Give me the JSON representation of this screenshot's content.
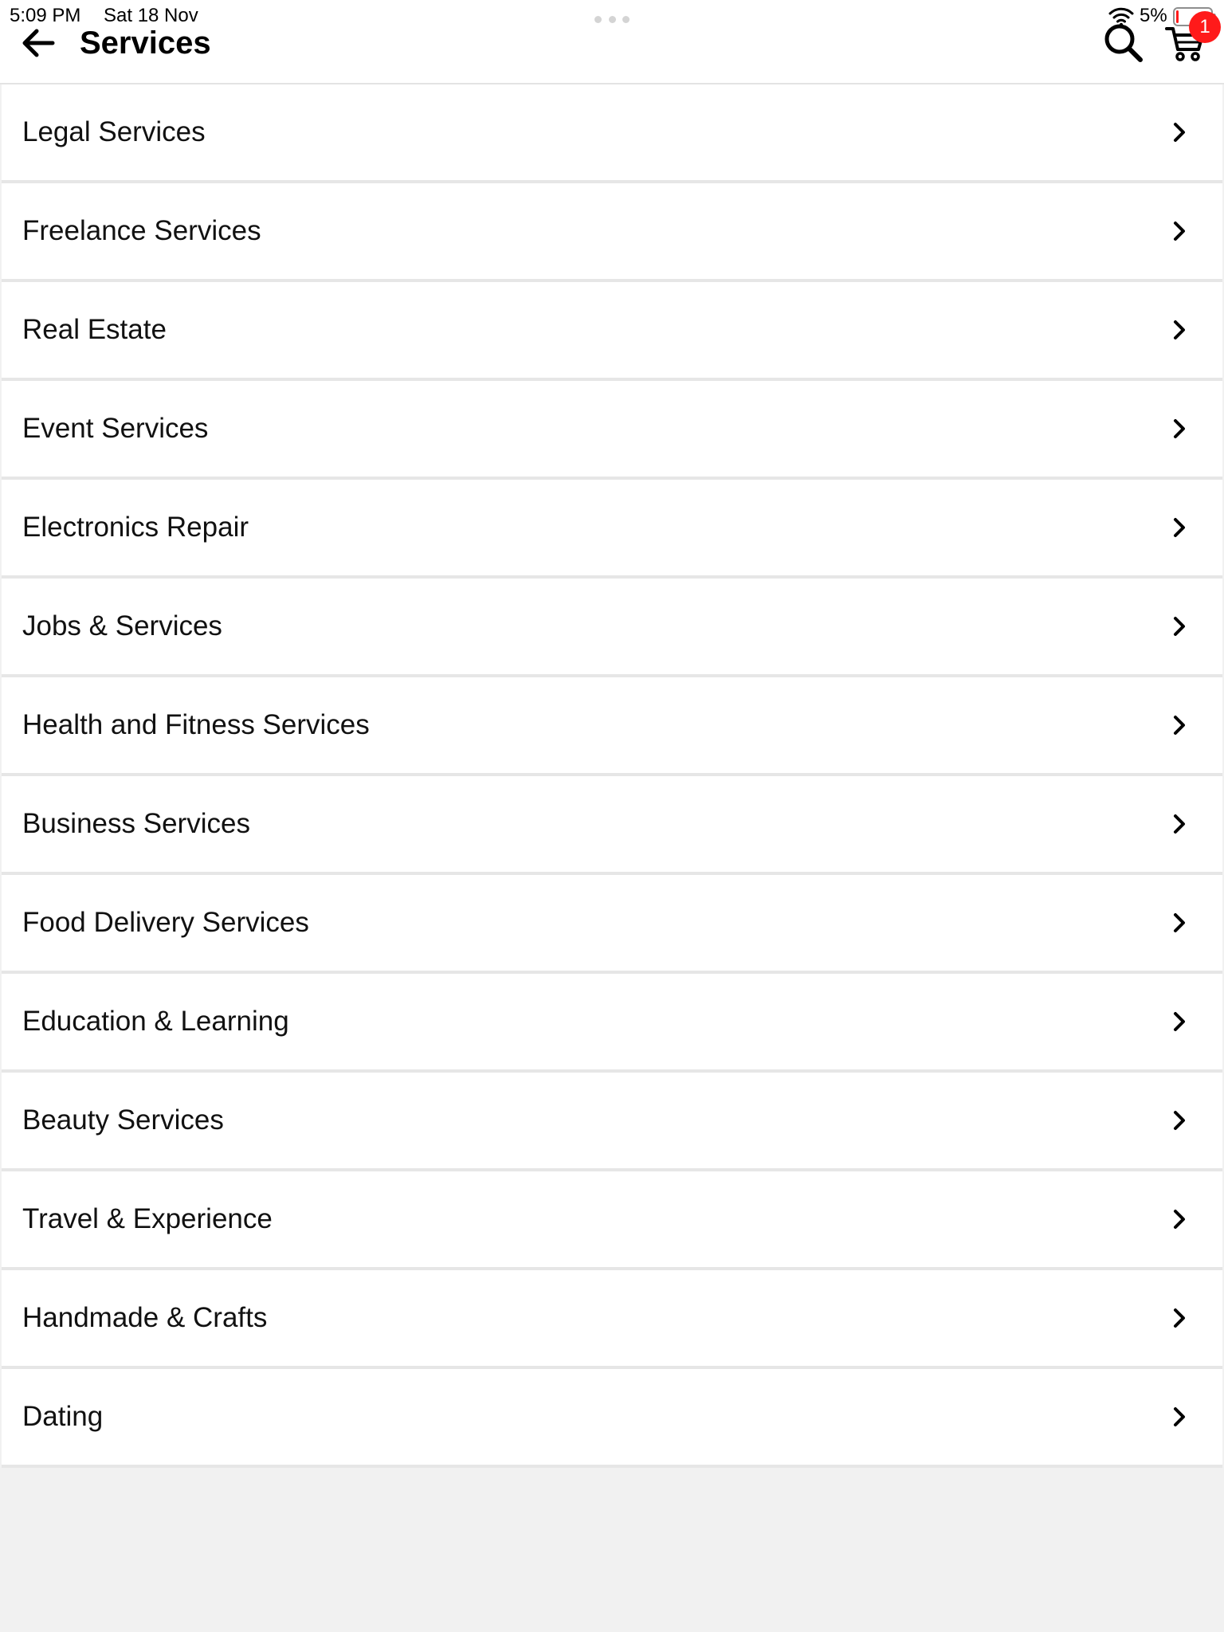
{
  "status_bar": {
    "time": "5:09 PM",
    "date": "Sat 18 Nov",
    "battery_percent": "5%",
    "battery_level": 0.05
  },
  "header": {
    "title": "Services",
    "back_icon": "arrow-left-icon",
    "search_icon": "search-icon",
    "cart_icon": "cart-icon",
    "cart_badge": "1"
  },
  "colors": {
    "badge": "#ff1a1a",
    "background": "#f1f1f1",
    "item_background": "#ffffff",
    "divider": "#e6e6e6"
  },
  "services": [
    {
      "label": "Legal Services"
    },
    {
      "label": "Freelance Services"
    },
    {
      "label": "Real Estate"
    },
    {
      "label": "Event Services"
    },
    {
      "label": "Electronics Repair"
    },
    {
      "label": "Jobs & Services"
    },
    {
      "label": "Health and Fitness Services"
    },
    {
      "label": "Business Services"
    },
    {
      "label": "Food Delivery Services"
    },
    {
      "label": "Education & Learning"
    },
    {
      "label": "Beauty Services"
    },
    {
      "label": "Travel & Experience"
    },
    {
      "label": "Handmade & Crafts"
    },
    {
      "label": "Dating"
    }
  ]
}
